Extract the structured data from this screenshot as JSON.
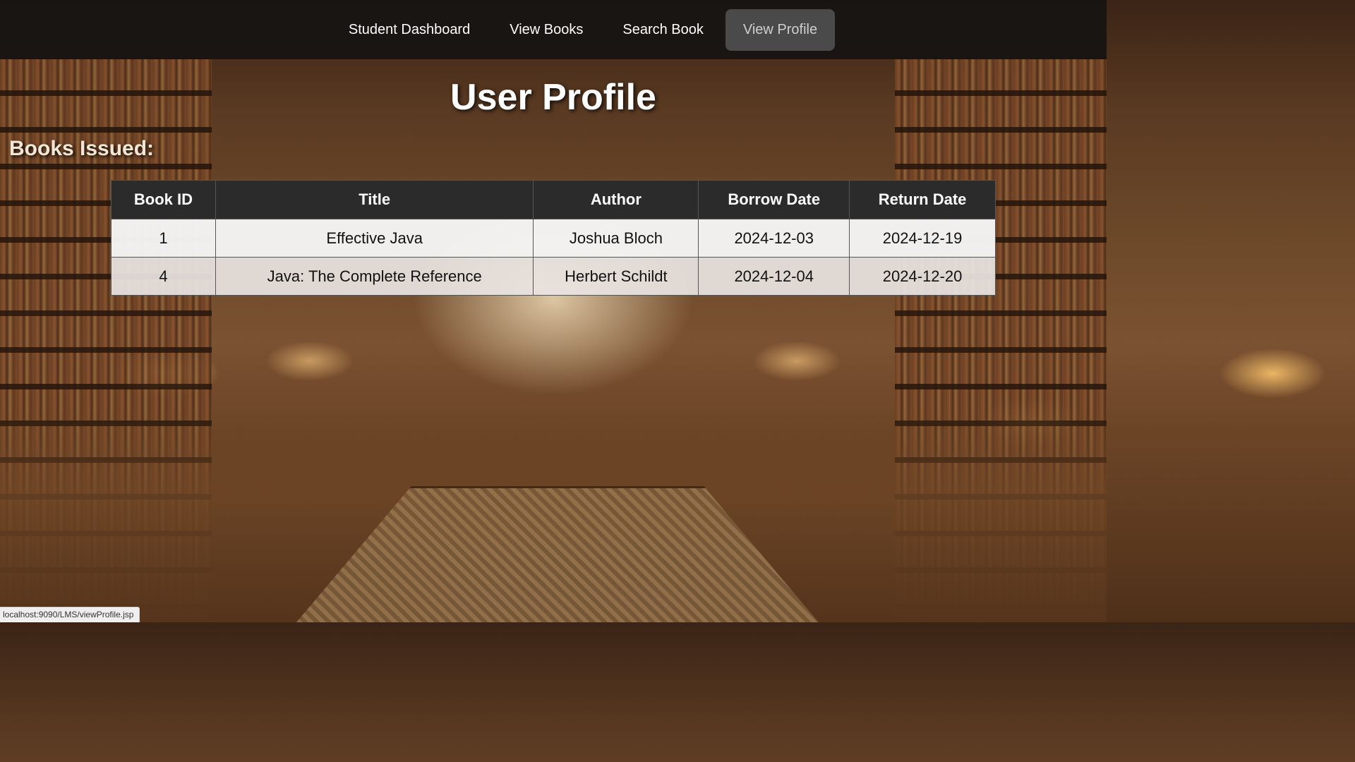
{
  "nav": {
    "items": [
      {
        "label": "Student Dashboard",
        "active": false
      },
      {
        "label": "View Books",
        "active": false
      },
      {
        "label": "Search Book",
        "active": false
      },
      {
        "label": "View Profile",
        "active": true
      }
    ]
  },
  "page": {
    "title": "User Profile",
    "section_heading": "Books Issued:"
  },
  "table": {
    "headers": [
      "Book ID",
      "Title",
      "Author",
      "Borrow Date",
      "Return Date"
    ],
    "rows": [
      [
        "1",
        "Effective Java",
        "Joshua Bloch",
        "2024-12-03",
        "2024-12-19"
      ],
      [
        "4",
        "Java: The Complete Reference",
        "Herbert Schildt",
        "2024-12-04",
        "2024-12-20"
      ]
    ]
  },
  "status_bar": {
    "url": "localhost:9090/LMS/viewProfile.jsp"
  },
  "colors": {
    "navbar_bg": "#161412",
    "active_tab_bg": "#4a4a4a",
    "table_header_bg": "#2b2b2b"
  }
}
